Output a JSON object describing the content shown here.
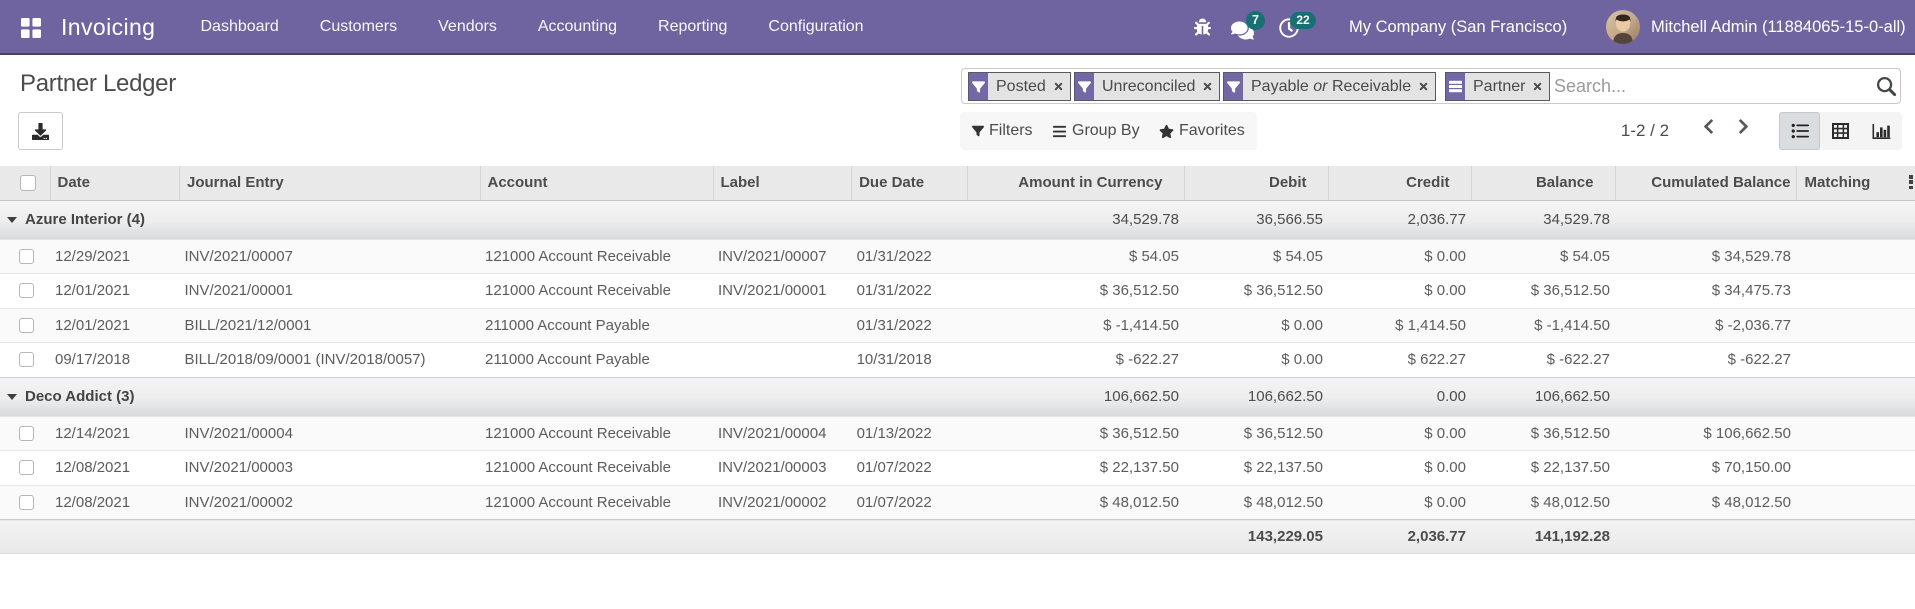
{
  "navbar": {
    "brand": "Invoicing",
    "menus": [
      "Dashboard",
      "Customers",
      "Vendors",
      "Accounting",
      "Reporting",
      "Configuration"
    ],
    "systray": {
      "messages_count": "7",
      "activities_count": "22",
      "company": "My Company (San Francisco)",
      "user": "Mitchell Admin (11884065-15-0-all)"
    }
  },
  "control_panel": {
    "title": "Partner Ledger",
    "search": {
      "facets": [
        {
          "label": "Posted"
        },
        {
          "label": "Unreconciled"
        },
        {
          "part1": "Payable",
          "part2": "or",
          "part3": "Receivable"
        },
        {
          "label": "Partner"
        }
      ],
      "placeholder": "Search...",
      "search_icon": "magnifier"
    },
    "tools": {
      "filters": "Filters",
      "group_by": "Group By",
      "favorites": "Favorites"
    },
    "pager": {
      "text": "1-2 / 2"
    }
  },
  "table": {
    "columns": {
      "date": "Date",
      "journal": "Journal Entry",
      "account": "Account",
      "label": "Label",
      "due": "Due Date",
      "amount": "Amount in Currency",
      "debit": "Debit",
      "credit": "Credit",
      "balance": "Balance",
      "cumulated": "Cumulated Balance",
      "matching": "Matching"
    },
    "groups": [
      {
        "label": "Azure Interior (4)",
        "totals": {
          "amount": "34,529.78",
          "debit": "36,566.55",
          "credit": "2,036.77",
          "balance": "34,529.78"
        },
        "rows": [
          {
            "date": "12/29/2021",
            "journal": "INV/2021/00007",
            "account": "121000 Account Receivable",
            "label": "INV/2021/00007",
            "due": "01/31/2022",
            "amount": "$ 54.05",
            "debit": "$ 54.05",
            "credit": "$ 0.00",
            "balance": "$ 54.05",
            "cumulated": "$ 34,529.78"
          },
          {
            "date": "12/01/2021",
            "journal": "INV/2021/00001",
            "account": "121000 Account Receivable",
            "label": "INV/2021/00001",
            "due": "01/31/2022",
            "amount": "$ 36,512.50",
            "debit": "$ 36,512.50",
            "credit": "$ 0.00",
            "balance": "$ 36,512.50",
            "cumulated": "$ 34,475.73"
          },
          {
            "date": "12/01/2021",
            "journal": "BILL/2021/12/0001",
            "account": "211000 Account Payable",
            "label": "",
            "due": "01/31/2022",
            "amount": "$ -1,414.50",
            "debit": "$ 0.00",
            "credit": "$ 1,414.50",
            "balance": "$ -1,414.50",
            "cumulated": "$ -2,036.77"
          },
          {
            "date": "09/17/2018",
            "journal": "BILL/2018/09/0001 (INV/2018/0057)",
            "account": "211000 Account Payable",
            "label": "",
            "due": "10/31/2018",
            "amount": "$ -622.27",
            "debit": "$ 0.00",
            "credit": "$ 622.27",
            "balance": "$ -622.27",
            "cumulated": "$ -622.27"
          }
        ]
      },
      {
        "label": "Deco Addict (3)",
        "totals": {
          "amount": "106,662.50",
          "debit": "106,662.50",
          "credit": "0.00",
          "balance": "106,662.50"
        },
        "rows": [
          {
            "date": "12/14/2021",
            "journal": "INV/2021/00004",
            "account": "121000 Account Receivable",
            "label": "INV/2021/00004",
            "due": "01/13/2022",
            "amount": "$ 36,512.50",
            "debit": "$ 36,512.50",
            "credit": "$ 0.00",
            "balance": "$ 36,512.50",
            "cumulated": "$ 106,662.50"
          },
          {
            "date": "12/08/2021",
            "journal": "INV/2021/00003",
            "account": "121000 Account Receivable",
            "label": "INV/2021/00003",
            "due": "01/07/2022",
            "amount": "$ 22,137.50",
            "debit": "$ 22,137.50",
            "credit": "$ 0.00",
            "balance": "$ 22,137.50",
            "cumulated": "$ 70,150.00"
          },
          {
            "date": "12/08/2021",
            "journal": "INV/2021/00002",
            "account": "121000 Account Receivable",
            "label": "INV/2021/00002",
            "due": "01/07/2022",
            "amount": "$ 48,012.50",
            "debit": "$ 48,012.50",
            "credit": "$ 0.00",
            "balance": "$ 48,012.50",
            "cumulated": "$ 48,012.50"
          }
        ]
      }
    ],
    "footer": {
      "debit": "143,229.05",
      "credit": "2,036.77",
      "balance": "141,192.28"
    }
  },
  "colors": {
    "navbar_bg": "#6f64a0",
    "badge_bg": "#177173",
    "facet_icon_bg": "#6d5fa6",
    "header_bg": "#e9e9e9"
  }
}
